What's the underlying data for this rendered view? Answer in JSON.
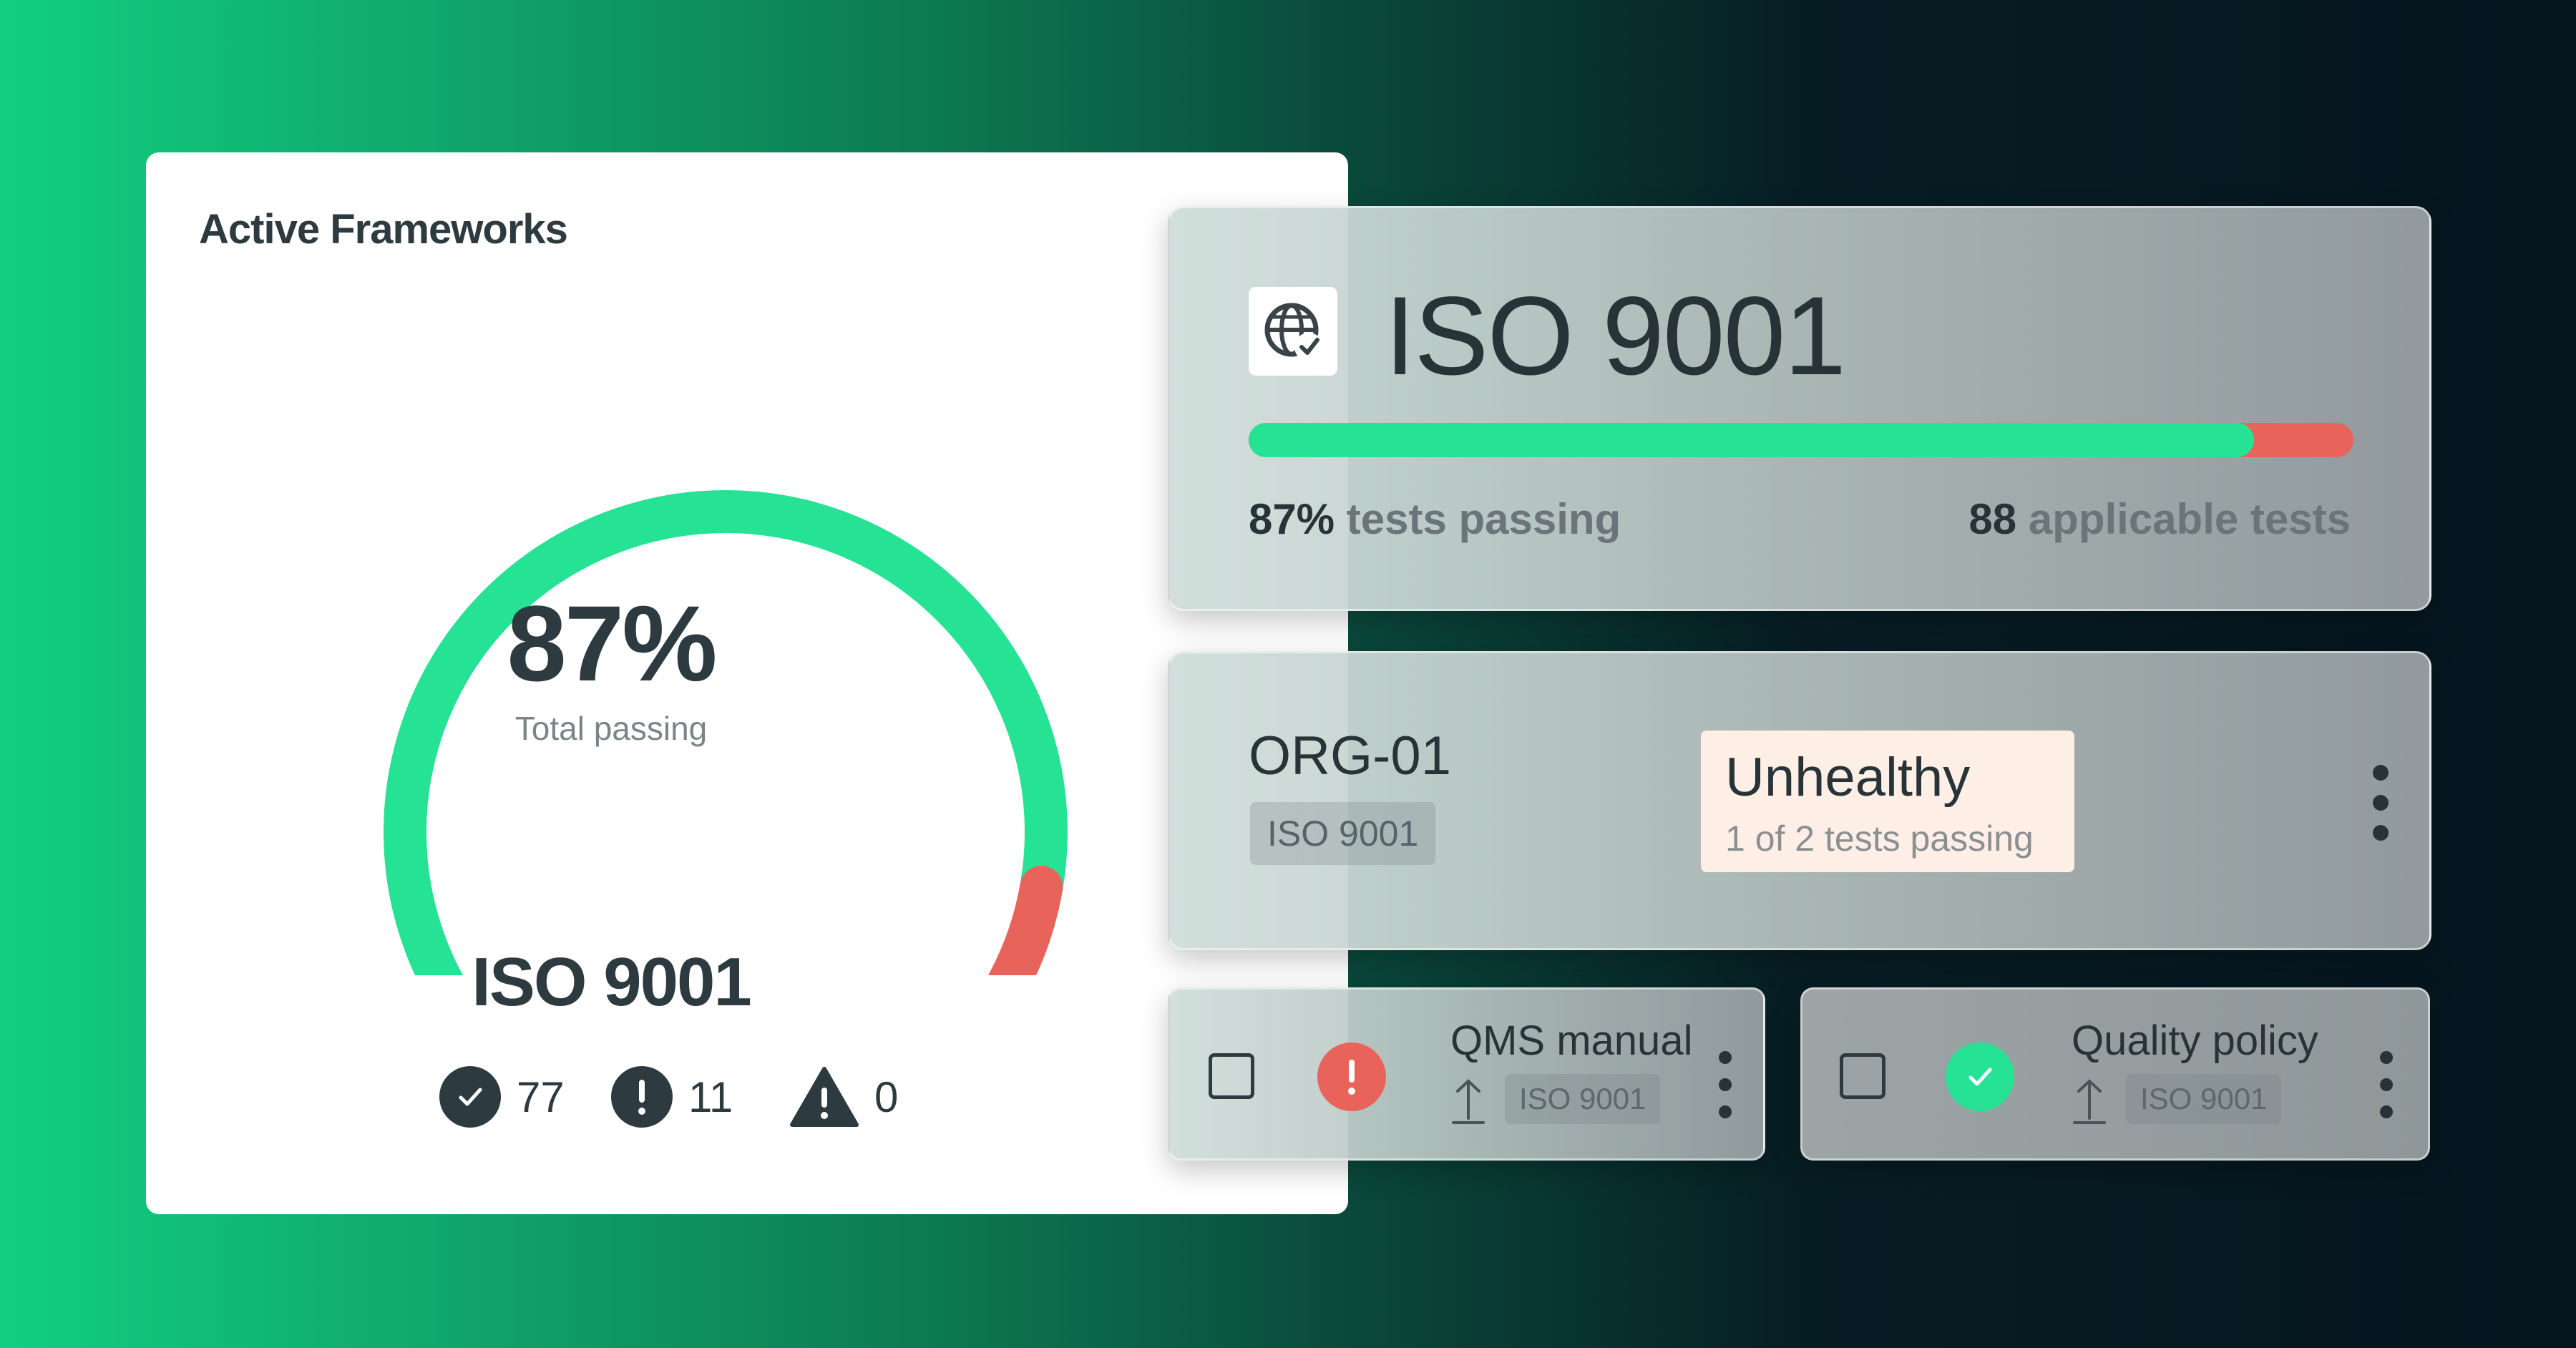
{
  "colors": {
    "pass": "#26e294",
    "fail": "#e8645a",
    "text_dark": "#283338",
    "bg_left": "#11cf80",
    "bg_right": "#06141e"
  },
  "frameworks_card": {
    "title": "Active Frameworks",
    "gauge": {
      "percent_label": "87%",
      "subtitle": "Total passing",
      "pass_fraction": 0.87
    },
    "framework_name": "ISO 9001",
    "stats": [
      {
        "icon": "check-circle-icon",
        "value": "77"
      },
      {
        "icon": "exclamation-circle-icon",
        "value": "11"
      },
      {
        "icon": "warning-triangle-icon",
        "value": "0"
      }
    ]
  },
  "iso_card": {
    "icon": "globe-check-icon",
    "title": "ISO 9001",
    "progress_fraction": 0.91,
    "passing_value": "87%",
    "passing_label": "tests passing",
    "applicable_value": "88",
    "applicable_label": "applicable tests"
  },
  "control_card": {
    "id": "ORG-01",
    "framework_tag": "ISO 9001",
    "health_status": "Unhealthy",
    "health_detail": "1 of 2 tests passing"
  },
  "tasks": [
    {
      "title": "QMS manual",
      "tag": "ISO 9001",
      "status": "failing",
      "status_icon": "exclamation-icon",
      "status_color": "#e8645a"
    },
    {
      "title": "Quality policy",
      "tag": "ISO 9001",
      "status": "passing",
      "status_icon": "check-icon",
      "status_color": "#26e294"
    }
  ]
}
